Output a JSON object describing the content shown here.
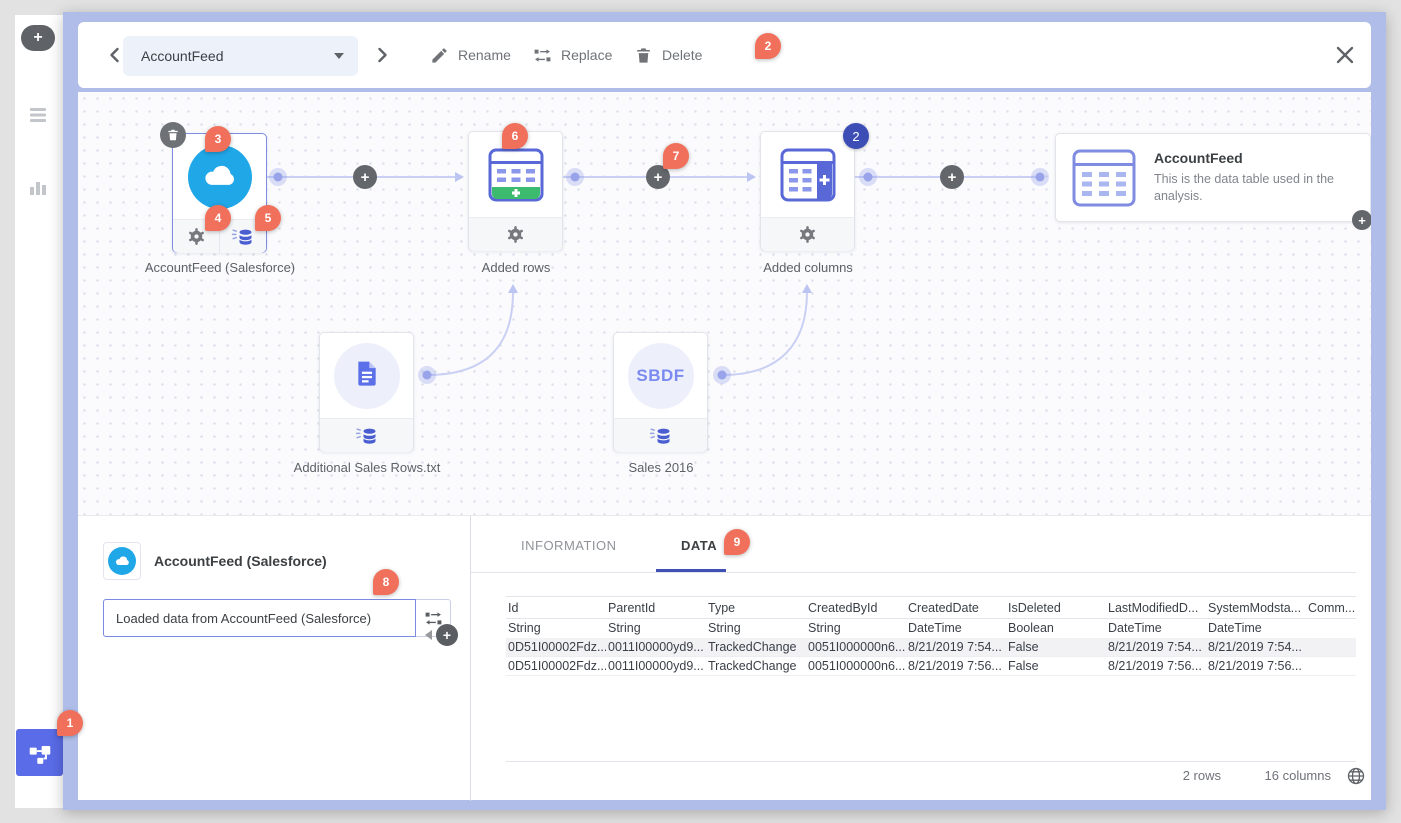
{
  "toolbar": {
    "selected_table": "AccountFeed",
    "rename_label": "Rename",
    "replace_label": "Replace",
    "delete_label": "Delete"
  },
  "badges": {
    "n1": "1",
    "n2": "2",
    "n3": "3",
    "n4": "4",
    "n5": "5",
    "n6": "6",
    "n7": "7",
    "n8": "8",
    "n9": "9"
  },
  "canvas": {
    "nodes": {
      "source": {
        "label": "AccountFeed (Salesforce)"
      },
      "added_rows": {
        "label": "Added rows"
      },
      "added_columns": {
        "label": "Added columns",
        "count": "2"
      },
      "final": {
        "title": "AccountFeed",
        "description": "This is the data table used in the analysis."
      },
      "file": {
        "label": "Additional Sales Rows.txt"
      },
      "sbdf": {
        "label": "Sales 2016",
        "icon_text": "SBDF"
      }
    }
  },
  "details": {
    "title": "AccountFeed (Salesforce)",
    "operation": "Loaded data from AccountFeed (Salesforce)"
  },
  "tabs": {
    "information": "INFORMATION",
    "data": "DATA"
  },
  "table": {
    "columns": [
      {
        "name": "Id",
        "type": "String",
        "values": [
          "0D51I00002Fdz...",
          "0D51I00002Fdz..."
        ]
      },
      {
        "name": "ParentId",
        "type": "String",
        "values": [
          "0011I00000yd9...",
          "0011I00000yd9..."
        ]
      },
      {
        "name": "Type",
        "type": "String",
        "values": [
          "TrackedChange",
          "TrackedChange"
        ]
      },
      {
        "name": "CreatedById",
        "type": "String",
        "values": [
          "0051I000000n6...",
          "0051I000000n6..."
        ]
      },
      {
        "name": "CreatedDate",
        "type": "DateTime",
        "values": [
          "8/21/2019 7:54...",
          "8/21/2019 7:56..."
        ]
      },
      {
        "name": "IsDeleted",
        "type": "Boolean",
        "values": [
          "False",
          "False"
        ]
      },
      {
        "name": "LastModifiedD...",
        "type": "DateTime",
        "values": [
          "8/21/2019 7:54...",
          "8/21/2019 7:56..."
        ]
      },
      {
        "name": "SystemModsta...",
        "type": "DateTime",
        "values": [
          "8/21/2019 7:54...",
          "8/21/2019 7:56..."
        ]
      },
      {
        "name": "Comm...",
        "type": "",
        "values": [
          "",
          ""
        ]
      }
    ],
    "row_count": "2 rows",
    "column_count": "16 columns"
  },
  "colors": {
    "accent": "#3f51b5",
    "annotation_badge": "#f1705b",
    "count_badge": "#3c4eb5",
    "node_blue": "#5868d6",
    "cloud_blue": "#20a7e8",
    "add_green": "#3cba6e"
  }
}
